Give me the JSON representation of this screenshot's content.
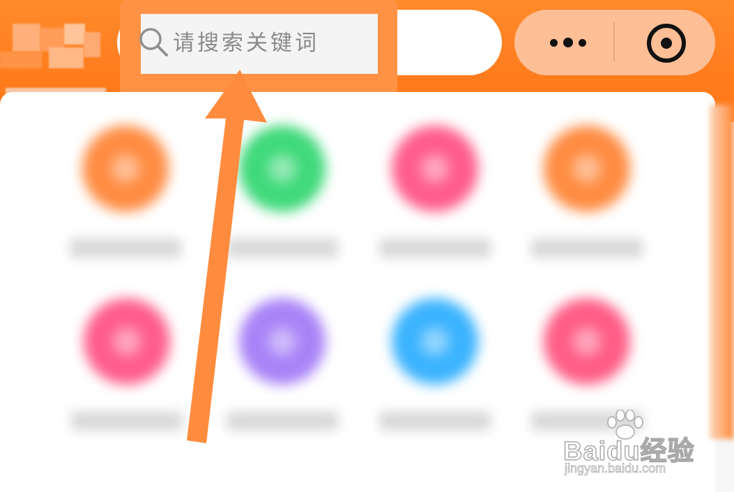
{
  "search": {
    "placeholder": "请搜索关键词"
  },
  "capsule": {
    "more_icon": "more-dots-icon",
    "close_icon": "target-circle-icon"
  },
  "icons": {
    "search": "search-icon",
    "arrow": "arrow-up-annotation"
  },
  "colors": {
    "header": "#ff7b1c",
    "highlight": "#ff9244",
    "capsule": "#ffbf96",
    "grid_row1": [
      "#ff8c42",
      "#3fd97a",
      "#ff5d8c",
      "#ff8c42"
    ],
    "grid_row2": [
      "#ff5d8c",
      "#a883f7",
      "#3bb3ff",
      "#ff5d86"
    ]
  },
  "watermark": {
    "brand": "Baidu经验",
    "url": "jingyan.baidu.com"
  }
}
